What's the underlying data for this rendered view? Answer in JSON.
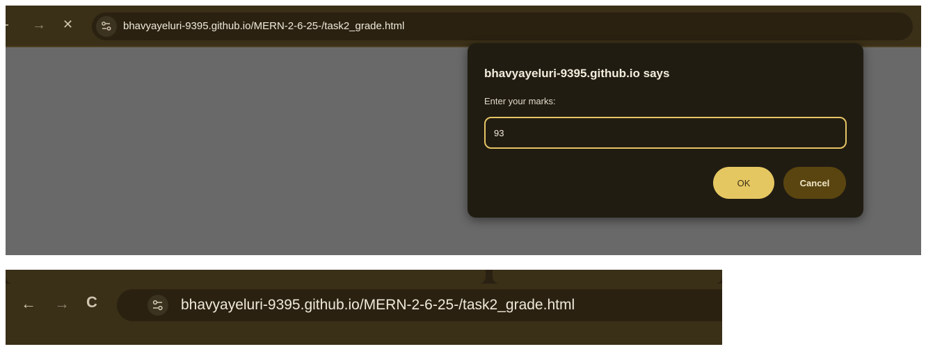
{
  "top": {
    "nav": {
      "back_icon": "back-arrow-icon",
      "forward_glyph": "→",
      "stop_glyph": "✕"
    },
    "url": "bhavyayeluri-9395.github.io/MERN-2-6-25-/task2_grade.html",
    "dialog": {
      "title": "bhavyayeluri-9395.github.io says",
      "message": "Enter your marks:",
      "input_value": "93",
      "ok_label": "OK",
      "cancel_label": "Cancel"
    }
  },
  "bottom": {
    "nav": {
      "back_glyph": "←",
      "forward_glyph": "→",
      "reload_glyph": "C"
    },
    "url": "bhavyayeluri-9395.github.io/MERN-2-6-25-/task2_grade.html"
  },
  "colors": {
    "toolbar": "#3a2f17",
    "dialog_bg": "#211c12",
    "accent": "#e5c762",
    "cancel_bg": "#5a4510",
    "page_gray": "#696969"
  }
}
